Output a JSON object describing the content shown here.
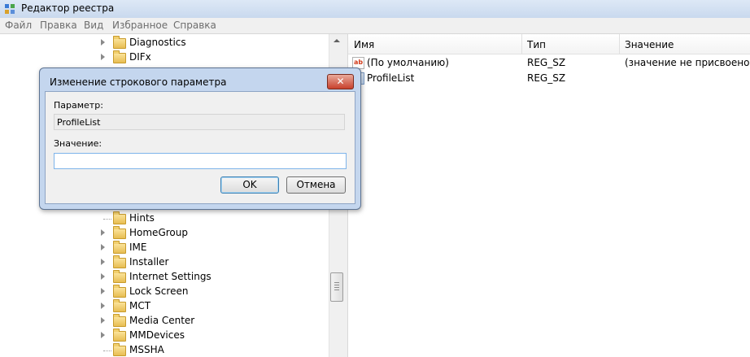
{
  "window": {
    "title": "Редактор реестра",
    "app_icon": "registry-editor-icon"
  },
  "menu": [
    "Файл",
    "Правка",
    "Вид",
    "Избранное",
    "Справка"
  ],
  "tree": {
    "items": [
      {
        "label": "Diagnostics",
        "expander": true
      },
      {
        "label": "DIFx",
        "expander": true
      },
      {
        "label": "Hints",
        "expander": false
      },
      {
        "label": "HomeGroup",
        "expander": true
      },
      {
        "label": "IME",
        "expander": true
      },
      {
        "label": "Installer",
        "expander": true
      },
      {
        "label": "Internet Settings",
        "expander": true
      },
      {
        "label": "Lock Screen",
        "expander": true
      },
      {
        "label": "MCT",
        "expander": true
      },
      {
        "label": "Media Center",
        "expander": true
      },
      {
        "label": "MMDevices",
        "expander": true
      },
      {
        "label": "MSSHA",
        "expander": false
      }
    ]
  },
  "list": {
    "columns": [
      "Имя",
      "Тип",
      "Значение"
    ],
    "rows": [
      {
        "name": "(По умолчанию)",
        "type": "REG_SZ",
        "value": "(значение не присвоено)",
        "icon": "string-value-icon"
      },
      {
        "name": "ProfileList",
        "type": "REG_SZ",
        "value": "",
        "icon": "string-value-icon"
      }
    ]
  },
  "dialog": {
    "title": "Изменение строкового параметра",
    "param_label": "Параметр:",
    "param_value": "ProfileList",
    "value_label": "Значение:",
    "value_input": "",
    "ok_label": "OK",
    "cancel_label": "Отмена",
    "close_glyph": "✕"
  }
}
